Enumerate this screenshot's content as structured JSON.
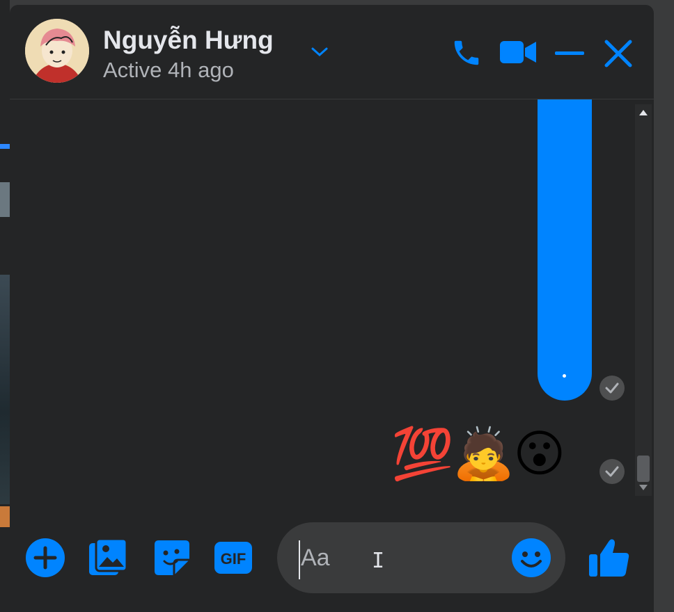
{
  "contact": {
    "name": "Nguyễn Hưng",
    "status": "Active 4h ago"
  },
  "header": {
    "actions": [
      "phone-icon",
      "video-camera-icon",
      "minimize-icon",
      "close-icon"
    ]
  },
  "messages": {
    "reactions_text": "💯🙇😮"
  },
  "composer": {
    "placeholder": "Aa",
    "tools": [
      "plus-icon",
      "photo-icon",
      "sticker-icon",
      "gif-icon"
    ],
    "gif_label": "GIF"
  },
  "colors": {
    "accent": "#0084ff",
    "panel": "#242526",
    "input": "#3a3b3c",
    "text_primary": "#e4e6eb",
    "text_secondary": "#b0b3b8"
  }
}
